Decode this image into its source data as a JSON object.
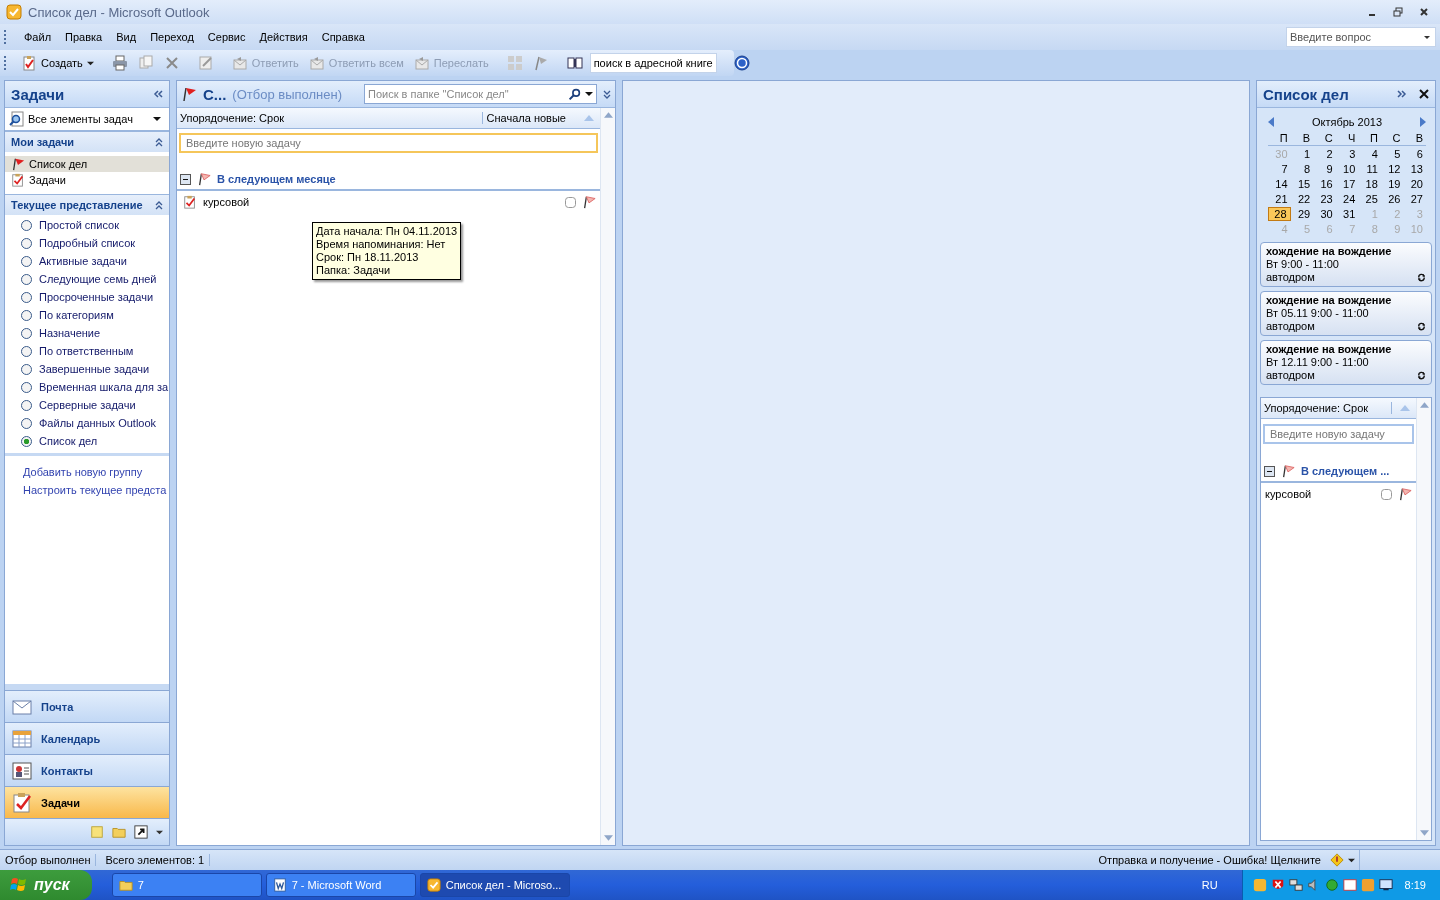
{
  "window": {
    "title": "Список дел - Microsoft Outlook"
  },
  "menu": [
    {
      "label": "Файл"
    },
    {
      "label": "Правка"
    },
    {
      "label": "Вид"
    },
    {
      "label": "Переход"
    },
    {
      "label": "Сервис"
    },
    {
      "label": "Действия"
    },
    {
      "label": "Справка"
    }
  ],
  "help_search": {
    "placeholder": "Введите вопрос"
  },
  "toolbar": {
    "new_button": {
      "label": "Создать"
    },
    "actions": [
      {
        "label": "Ответить",
        "disabled": true
      },
      {
        "label": "Ответить всем",
        "disabled": true
      },
      {
        "label": "Переслать",
        "disabled": true
      }
    ],
    "address_search": {
      "value": "поиск в адресной книге"
    }
  },
  "nav": {
    "title": "Задачи",
    "view_selector": "Все элементы задач",
    "my_tasks": {
      "title": "Мои задачи",
      "items": [
        {
          "label": "Список дел",
          "selected": true,
          "kind": "flag"
        },
        {
          "label": "Задачи",
          "selected": false,
          "kind": "tasks"
        }
      ]
    },
    "current_view": {
      "title": "Текущее представление",
      "options": [
        {
          "label": "Простой список",
          "selected": false
        },
        {
          "label": "Подробный список",
          "selected": false
        },
        {
          "label": "Активные задачи",
          "selected": false
        },
        {
          "label": "Следующие семь дней",
          "selected": false
        },
        {
          "label": "Просроченные задачи",
          "selected": false
        },
        {
          "label": "По категориям",
          "selected": false
        },
        {
          "label": "Назначение",
          "selected": false
        },
        {
          "label": "По ответственным",
          "selected": false
        },
        {
          "label": "Завершенные задачи",
          "selected": false
        },
        {
          "label": "Временная шкала для за",
          "selected": false
        },
        {
          "label": "Серверные задачи",
          "selected": false
        },
        {
          "label": "Файлы данных Outlook",
          "selected": false
        },
        {
          "label": "Список дел",
          "selected": true
        }
      ]
    },
    "links": [
      "Добавить новую группу",
      "Настроить текущее предста"
    ],
    "buttons": [
      {
        "label": "Почта",
        "kind": "mail",
        "selected": false
      },
      {
        "label": "Календарь",
        "kind": "calendar",
        "selected": false
      },
      {
        "label": "Контакты",
        "kind": "contacts",
        "selected": false
      },
      {
        "label": "Задачи",
        "kind": "tasks",
        "selected": true
      }
    ]
  },
  "task_list": {
    "title": "С...",
    "filter": "(Отбор выполнен)",
    "search": {
      "placeholder": "Поиск в папке \"Список дел\""
    },
    "arrange": "Упорядочение: Срок",
    "order": "Сначала новые",
    "new_task": {
      "placeholder": "Введите новую задачу"
    },
    "groups": [
      {
        "title": "В следующем месяце",
        "expanded": true,
        "tasks": [
          {
            "subject": "курсовой",
            "complete": false
          }
        ]
      }
    ],
    "tooltip": [
      "Дата начала: Пн 04.11.2013",
      "Время напоминания: Нет",
      "Срок: Пн 18.11.2013",
      "Папка: Задачи"
    ]
  },
  "todo_bar": {
    "title": "Список дел",
    "calendar": {
      "month": "Октябрь 2013",
      "weekdays": [
        "П",
        "В",
        "С",
        "Ч",
        "П",
        "С",
        "В"
      ],
      "weeks": [
        [
          {
            "day": "30",
            "muted": true,
            "today": false
          },
          {
            "day": "1",
            "muted": false,
            "today": false
          },
          {
            "day": "2",
            "muted": false,
            "today": false
          },
          {
            "day": "3",
            "muted": false,
            "today": false
          },
          {
            "day": "4",
            "muted": false,
            "today": false
          },
          {
            "day": "5",
            "muted": false,
            "today": false
          },
          {
            "day": "6",
            "muted": false,
            "today": false
          }
        ],
        [
          {
            "day": "7",
            "muted": false,
            "today": false
          },
          {
            "day": "8",
            "muted": false,
            "today": false
          },
          {
            "day": "9",
            "muted": false,
            "today": false
          },
          {
            "day": "10",
            "muted": false,
            "today": false
          },
          {
            "day": "11",
            "muted": false,
            "today": false
          },
          {
            "day": "12",
            "muted": false,
            "today": false
          },
          {
            "day": "13",
            "muted": false,
            "today": false
          }
        ],
        [
          {
            "day": "14",
            "muted": false,
            "today": false
          },
          {
            "day": "15",
            "muted": false,
            "today": false
          },
          {
            "day": "16",
            "muted": false,
            "today": false
          },
          {
            "day": "17",
            "muted": false,
            "today": false
          },
          {
            "day": "18",
            "muted": false,
            "today": false
          },
          {
            "day": "19",
            "muted": false,
            "today": false
          },
          {
            "day": "20",
            "muted": false,
            "today": false
          }
        ],
        [
          {
            "day": "21",
            "muted": false,
            "today": false
          },
          {
            "day": "22",
            "muted": false,
            "today": false
          },
          {
            "day": "23",
            "muted": false,
            "today": false
          },
          {
            "day": "24",
            "muted": false,
            "today": false
          },
          {
            "day": "25",
            "muted": false,
            "today": false
          },
          {
            "day": "26",
            "muted": false,
            "today": false
          },
          {
            "day": "27",
            "muted": false,
            "today": false
          }
        ],
        [
          {
            "day": "28",
            "muted": false,
            "today": true
          },
          {
            "day": "29",
            "muted": false,
            "today": false
          },
          {
            "day": "30",
            "muted": false,
            "today": false
          },
          {
            "day": "31",
            "muted": false,
            "today": false
          },
          {
            "day": "1",
            "muted": true,
            "today": false
          },
          {
            "day": "2",
            "muted": true,
            "today": false
          },
          {
            "day": "3",
            "muted": true,
            "today": false
          }
        ],
        [
          {
            "day": "4",
            "muted": true,
            "today": false
          },
          {
            "day": "5",
            "muted": true,
            "today": false
          },
          {
            "day": "6",
            "muted": true,
            "today": false
          },
          {
            "day": "7",
            "muted": true,
            "today": false
          },
          {
            "day": "8",
            "muted": true,
            "today": false
          },
          {
            "day": "9",
            "muted": true,
            "today": false
          },
          {
            "day": "10",
            "muted": true,
            "today": false
          }
        ]
      ]
    },
    "appointments": [
      {
        "title": "хождение на вождение",
        "time": "Вт 9:00 - 11:00",
        "location": "автодром"
      },
      {
        "title": "хождение на вождение",
        "time": "Вт 05.11 9:00 - 11:00",
        "location": "автодром"
      },
      {
        "title": "хождение на вождение",
        "time": "Вт 12.11 9:00 - 11:00",
        "location": "автодром"
      }
    ],
    "arrange": "Упорядочение: Срок",
    "new_task": {
      "placeholder": "Введите новую задачу"
    },
    "groups": [
      {
        "title": "В следующем ...",
        "expanded": true,
        "tasks": [
          {
            "subject": "курсовой",
            "complete": false
          }
        ]
      }
    ]
  },
  "status_bar": {
    "filter": "Отбор выполнен",
    "count": "Всего элементов: 1",
    "send_receive": "Отправка и получение - Ошибка! Щелкните"
  },
  "taskbar": {
    "start": "пуск",
    "windows": [
      {
        "label": "7",
        "kind": "folder",
        "selected": false
      },
      {
        "label": "7 - Microsoft Word",
        "kind": "word",
        "selected": false
      },
      {
        "label": "Список дел - Microso...",
        "kind": "outlook",
        "selected": true
      }
    ],
    "language": "RU",
    "clock": "8:19"
  }
}
